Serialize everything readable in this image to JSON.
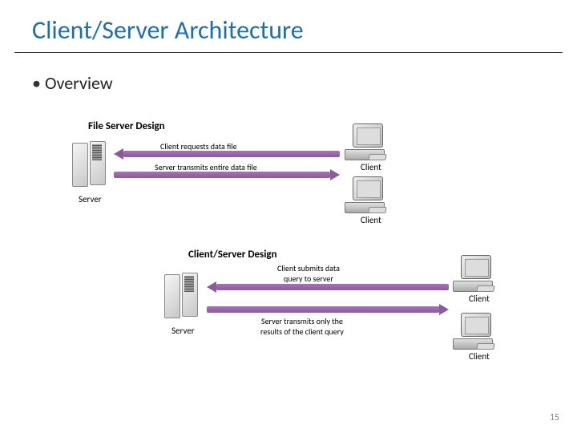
{
  "title": "Client/Server Architecture",
  "bullet": "Overview",
  "page_number": "15",
  "diagram1": {
    "title": "File Server Design",
    "server_label": "Server",
    "client_label": "Client",
    "arrow1": "Client requests data file",
    "arrow2": "Server transmits entire data file"
  },
  "diagram2": {
    "title": "Client/Server Design",
    "server_label": "Server",
    "client_label": "Client",
    "arrow1": "Client submits data\nquery to server",
    "arrow1_line1": "Client submits data",
    "arrow1_line2": "query to server",
    "arrow2_line1": "Server transmits only the",
    "arrow2_line2": "results of the client query"
  }
}
